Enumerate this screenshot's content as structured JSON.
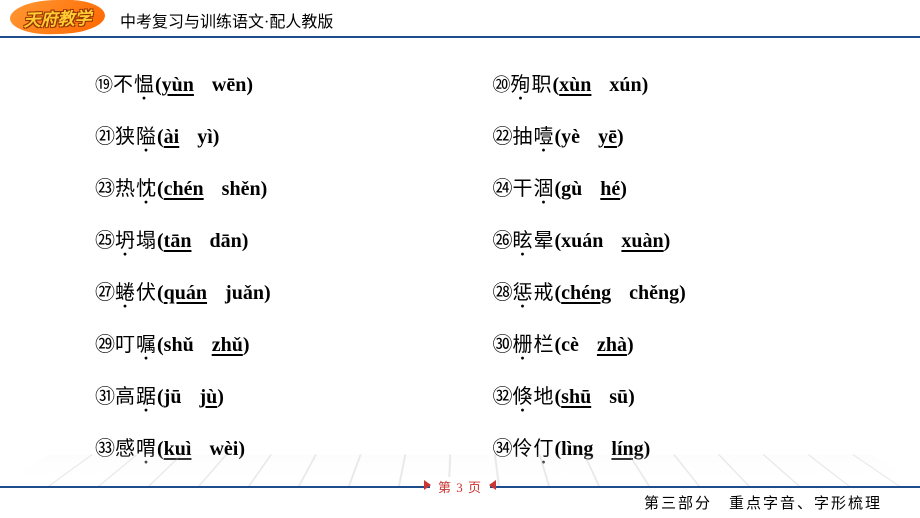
{
  "logo_text": "天府教学",
  "header_title": "中考复习与训练语文·配人教版",
  "entries": [
    {
      "num": "⑲",
      "small": true,
      "chars": [
        "不",
        "愠"
      ],
      "dotted": [
        false,
        true
      ],
      "p1": "yùn",
      "p2": "wēn",
      "correct": 1,
      "col": 1
    },
    {
      "num": "⑳",
      "small": true,
      "chars": [
        "殉",
        "职"
      ],
      "dotted": [
        true,
        false
      ],
      "p1": "xùn",
      "p2": "xún",
      "correct": 1,
      "col": 2
    },
    {
      "num": "㉑",
      "small": false,
      "chars": [
        "狭",
        "隘"
      ],
      "dotted": [
        false,
        true
      ],
      "p1": "ài",
      "p2": "yì",
      "correct": 1,
      "col": 1
    },
    {
      "num": "㉒",
      "small": false,
      "chars": [
        "抽",
        "噎"
      ],
      "dotted": [
        false,
        true
      ],
      "p1": "yè",
      "p2": "yē",
      "correct": 2,
      "col": 2
    },
    {
      "num": "㉓",
      "small": false,
      "chars": [
        "热",
        "忱"
      ],
      "dotted": [
        false,
        true
      ],
      "p1": "chén",
      "p2": "shěn",
      "correct": 1,
      "col": 1
    },
    {
      "num": "㉔",
      "small": false,
      "chars": [
        "干",
        "涸"
      ],
      "dotted": [
        false,
        true
      ],
      "p1": "gù",
      "p2": "hé",
      "correct": 2,
      "col": 2
    },
    {
      "num": "㉕",
      "small": false,
      "chars": [
        "坍",
        "塌"
      ],
      "dotted": [
        true,
        false
      ],
      "p1": "tān",
      "p2": "dān",
      "correct": 1,
      "col": 1
    },
    {
      "num": "㉖",
      "small": false,
      "chars": [
        "眩",
        "晕"
      ],
      "dotted": [
        true,
        false
      ],
      "p1": "xuán",
      "p2": "xuàn",
      "correct": 2,
      "col": 2
    },
    {
      "num": "㉗",
      "small": false,
      "chars": [
        "蜷",
        "伏"
      ],
      "dotted": [
        true,
        false
      ],
      "p1": "quán",
      "p2": "juǎn",
      "correct": 1,
      "col": 1
    },
    {
      "num": "㉘",
      "small": false,
      "chars": [
        "惩",
        "戒"
      ],
      "dotted": [
        true,
        false
      ],
      "p1": "chéng",
      "p2": "chěng",
      "correct": 1,
      "col": 2
    },
    {
      "num": "㉙",
      "small": false,
      "chars": [
        "叮",
        "嘱"
      ],
      "dotted": [
        false,
        true
      ],
      "p1": "shǔ",
      "p2": "zhǔ",
      "correct": 2,
      "col": 1
    },
    {
      "num": "㉚",
      "small": false,
      "chars": [
        "栅",
        "栏"
      ],
      "dotted": [
        true,
        false
      ],
      "p1": "cè",
      "p2": "zhà",
      "correct": 2,
      "col": 2
    },
    {
      "num": "㉛",
      "small": false,
      "chars": [
        "高",
        "踞"
      ],
      "dotted": [
        false,
        true
      ],
      "p1": "jū",
      "p2": "jù",
      "correct": 2,
      "col": 1
    },
    {
      "num": "㉜",
      "small": false,
      "chars": [
        "倏",
        "地"
      ],
      "dotted": [
        true,
        false
      ],
      "p1": "shū",
      "p2": "sū",
      "correct": 1,
      "col": 2
    },
    {
      "num": "㉝",
      "small": false,
      "chars": [
        "感",
        "喟"
      ],
      "dotted": [
        false,
        true
      ],
      "p1": "kuì",
      "p2": "wèi",
      "correct": 1,
      "col": 1
    },
    {
      "num": "㉞",
      "small": false,
      "chars": [
        "伶",
        "仃"
      ],
      "dotted": [
        false,
        true
      ],
      "p1": "lìng",
      "p2": "líng",
      "correct": 2,
      "col": 2
    }
  ],
  "page_label": "第 3 页",
  "footer_text": "第三部分　重点字音、字形梳理"
}
